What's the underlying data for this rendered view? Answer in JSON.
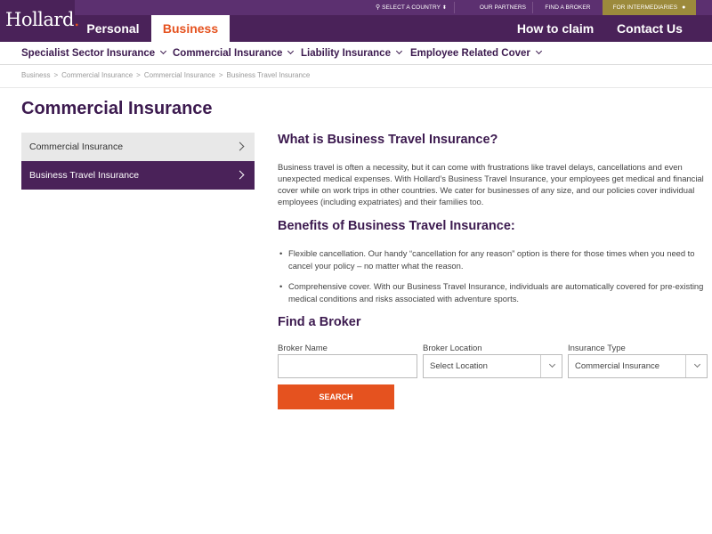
{
  "brand": {
    "logo_text": "Hollard",
    "logo_dot": "."
  },
  "utility": {
    "select_country": "SELECT A COUNTRY",
    "our_partners": "OUR PARTNERS",
    "find_broker": "FIND A BROKER",
    "for_intermediaries": "FOR INTERMEDIARIES"
  },
  "nav": {
    "personal": "Personal",
    "business": "Business",
    "how_to_claim": "How to claim",
    "contact_us": "Contact Us"
  },
  "subnav": {
    "items": [
      "Specialist Sector Insurance",
      "Commercial Insurance",
      "Liability Insurance",
      "Employee Related Cover"
    ]
  },
  "breadcrumb": [
    "Business",
    "Commercial Insurance",
    "Commercial Insurance",
    "Business Travel Insurance"
  ],
  "page_title": "Commercial Insurance",
  "side_menu": [
    "Commercial Insurance",
    "Business Travel Insurance"
  ],
  "content": {
    "h_what": "What is Business Travel Insurance?",
    "para_what": "Business travel is often a necessity, but it can come with frustrations like travel delays, cancellations and even unexpected medical expenses. With Hollard’s Business Travel Insurance, your employees get medical and financial cover while on work trips in other countries. We cater for businesses of any size, and our policies cover individual employees (including expatriates) and their families too.",
    "h_benefits": "Benefits of Business Travel Insurance:",
    "benefits": [
      "Flexible cancellation. Our handy “cancellation for any reason” option is there for those times when you need to cancel your policy – no matter what the reason.",
      "Comprehensive cover. With our Business Travel Insurance, individuals are automatically covered for pre-existing medical conditions and risks associated with adventure sports."
    ],
    "h_broker": "Find a Broker"
  },
  "form": {
    "broker_name_label": "Broker Name",
    "broker_name_value": "",
    "broker_location_label": "Broker Location",
    "broker_location_value": "Select Location",
    "insurance_type_label": "Insurance Type",
    "insurance_type_value": "Commercial Insurance",
    "search_label": "SEARCH"
  },
  "colors": {
    "brand_purple": "#4a2259",
    "accent_orange": "#e5521f",
    "gold": "#9c8a3c"
  }
}
